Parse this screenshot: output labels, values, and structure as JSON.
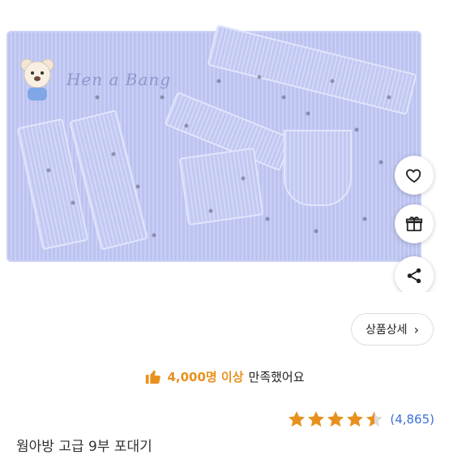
{
  "product": {
    "brand_watermark": "Hen a Bang",
    "title": "웜아방 고급 9부 포대기",
    "image_alt": "하늘색 포대기 제품 사진"
  },
  "actions": {
    "like_icon": "heart-icon",
    "gift_icon": "gift-icon",
    "share_icon": "share-icon",
    "detail_label": "상품상세"
  },
  "satisfaction": {
    "count_text": "4,000명 이상",
    "suffix_text": "만족했어요",
    "accent_color": "#e8901e"
  },
  "rating": {
    "stars": 4.5,
    "count": "(4,865)",
    "star_color": "#e8901e",
    "count_color": "#3d6fd8"
  }
}
